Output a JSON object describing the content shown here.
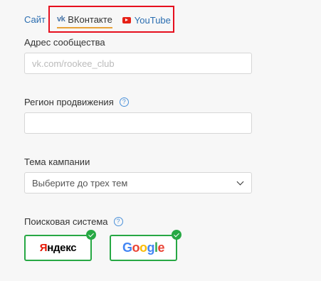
{
  "tabs": {
    "site": "Сайт",
    "vk_mark": "vk",
    "vk": "ВКонтакте",
    "youtube": "YouTube"
  },
  "community": {
    "label": "Адрес сообщества",
    "placeholder": "vk.com/rookee_club",
    "value": ""
  },
  "region": {
    "label": "Регион продвижения",
    "help": "?",
    "value": ""
  },
  "theme": {
    "label": "Тема кампании",
    "placeholder": "Выберите до трех тем"
  },
  "search_engine": {
    "label": "Поисковая система",
    "help": "?",
    "yandex_first": "Я",
    "yandex_rest": "ндекс",
    "google_letters": [
      "G",
      "o",
      "o",
      "g",
      "l",
      "e"
    ],
    "google_colors": [
      "#4285f4",
      "#ea4335",
      "#fbbc05",
      "#4285f4",
      "#34a853",
      "#ea4335"
    ],
    "yandex_selected": true,
    "google_selected": true
  },
  "colors": {
    "accent": "#2a6db0",
    "selected": "#27a844",
    "highlight": "#e60f1e",
    "tab_underline": "#e8a238"
  }
}
